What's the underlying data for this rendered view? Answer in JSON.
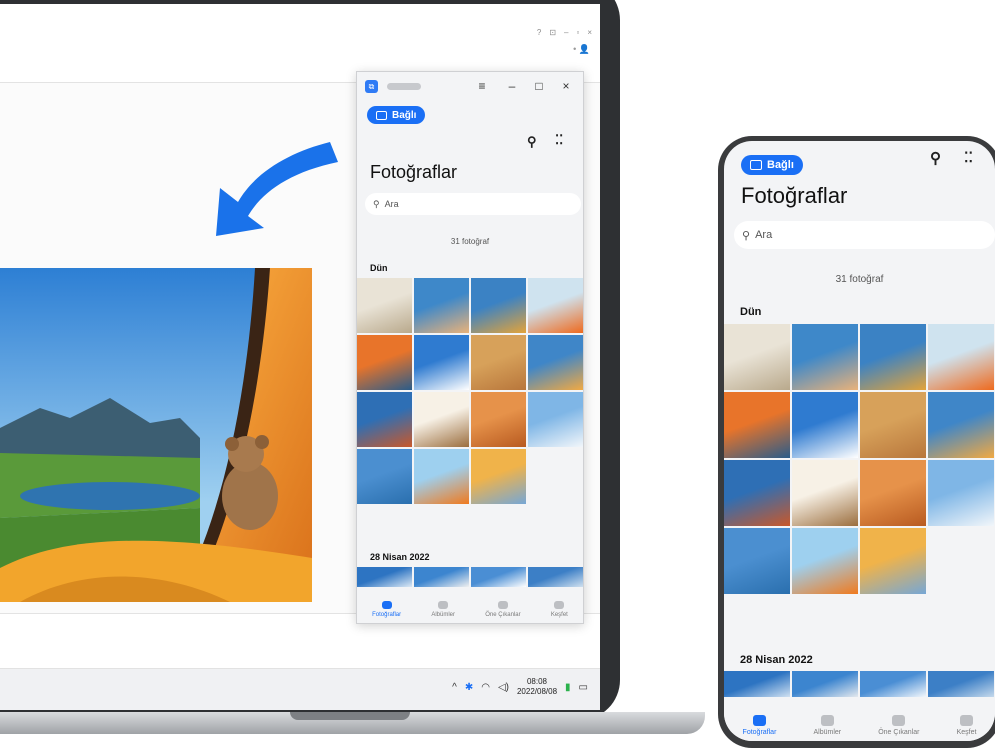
{
  "laptop": {
    "taskbar": {
      "time": "08:08",
      "date": "2022/08/08",
      "tray_icons": [
        "chevron-up-icon",
        "bluetooth-icon",
        "wifi-icon",
        "volume-icon",
        "battery-icon",
        "notification-icon"
      ]
    }
  },
  "app": {
    "connected_label": "Bağlı",
    "title": "Fotoğraflar",
    "search_placeholder": "Ara",
    "photo_count": "31 fotoğraf",
    "sections": [
      {
        "label": "Dün"
      },
      {
        "label": "28 Nisan 2022"
      }
    ],
    "nav": [
      {
        "label": "Fotoğraflar",
        "icon": "photos-icon",
        "active": true
      },
      {
        "label": "Albümler",
        "icon": "albums-icon",
        "active": false
      },
      {
        "label": "Öne Çıkanlar",
        "icon": "star-icon",
        "active": false
      },
      {
        "label": "Keşfet",
        "icon": "discover-icon",
        "active": false
      }
    ],
    "window_controls": [
      "menu",
      "minimize",
      "maximize",
      "close"
    ],
    "accent_color": "#1a6ff5"
  },
  "photos": [
    {
      "name": "dandelion",
      "colors": [
        "#e9e3d6",
        "#b9a98c"
      ]
    },
    {
      "name": "friends-selfie",
      "colors": [
        "#3e88c9",
        "#e9b27a"
      ]
    },
    {
      "name": "woman-field",
      "colors": [
        "#3b82c4",
        "#e3a33a"
      ]
    },
    {
      "name": "paper-boat",
      "colors": [
        "#cfe3ef",
        "#ee6a1e"
      ]
    },
    {
      "name": "still-life",
      "colors": [
        "#e8742a",
        "#2a5c8a"
      ]
    },
    {
      "name": "skier",
      "colors": [
        "#2f7bd0",
        "#ffffff"
      ]
    },
    {
      "name": "desert-camels",
      "colors": [
        "#d7a15a",
        "#b8763b"
      ]
    },
    {
      "name": "harbor",
      "colors": [
        "#3f86c8",
        "#f1a943"
      ]
    },
    {
      "name": "red-rocks",
      "colors": [
        "#2e6fb5",
        "#c9582a"
      ]
    },
    {
      "name": "beach-chairs",
      "colors": [
        "#f7f1e6",
        "#9b6e3e"
      ]
    },
    {
      "name": "sand-dunes",
      "colors": [
        "#e6924a",
        "#b85a20"
      ]
    },
    {
      "name": "snow-couple",
      "colors": [
        "#7fb6e6",
        "#f2f6fa"
      ]
    },
    {
      "name": "coast",
      "colors": [
        "#4b8fd0",
        "#2a6fae"
      ]
    },
    {
      "name": "orange-umbrella",
      "colors": [
        "#9ed0ef",
        "#f07a1e"
      ]
    },
    {
      "name": "tent-bear",
      "colors": [
        "#f0b34a",
        "#76a7d6"
      ]
    }
  ],
  "photos_next": [
    {
      "name": "mountain-lake",
      "colors": [
        "#2d74c2",
        "#dce9f5"
      ]
    },
    {
      "name": "climber",
      "colors": [
        "#3c85cf",
        "#f0f0f0"
      ]
    },
    {
      "name": "snow-peaks",
      "colors": [
        "#4a8ed4",
        "#ffffff"
      ]
    },
    {
      "name": "glacier",
      "colors": [
        "#3c7fc6",
        "#cfe0ef"
      ]
    }
  ]
}
